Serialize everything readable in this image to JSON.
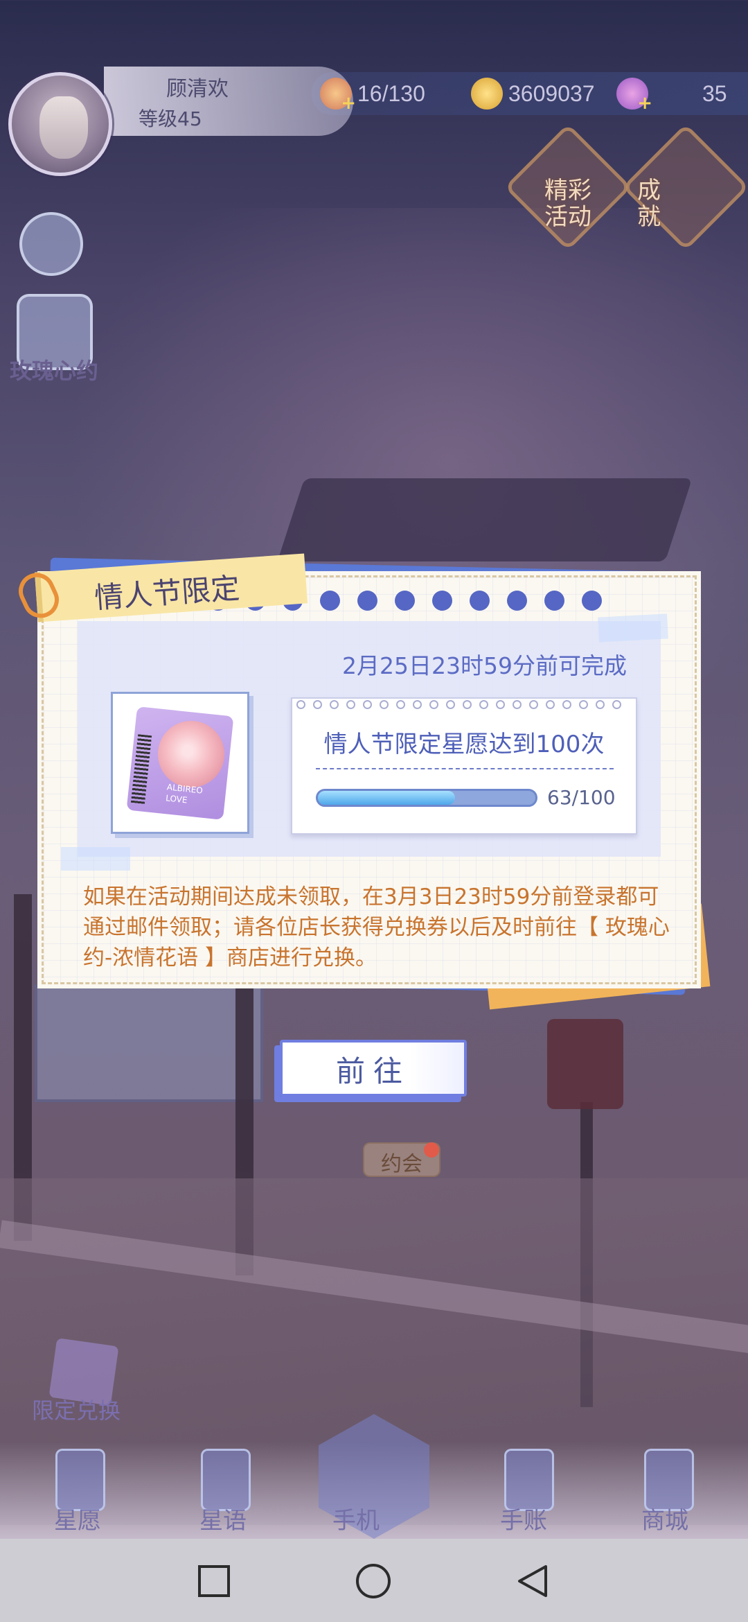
{
  "hud": {
    "player_name": "顾清欢",
    "player_level": "等级45",
    "stamina": "16/130",
    "gold": "3609037",
    "gems": "35",
    "plus_symbol": "+"
  },
  "top_icons": {
    "events_label": "精彩\n活动",
    "achievements_label": "成\n就"
  },
  "side": {
    "rose_promise_label": "玫瑰心约"
  },
  "modal": {
    "title": "情人节限定",
    "deadline": "2月25日23时59分前可完成",
    "task_text": "情人节限定星愿达到100次",
    "progress_text": "63/100",
    "progress_fraction": 0.63,
    "notice": "如果在活动期间达成未领取，在3月3日23时59分前登录都可通过邮件领取；请各位店长获得兑换券以后及时前往【 玫瑰心约-浓情花语 】商店进行兑换。",
    "ticket_text_1": "ALBIREO",
    "ticket_text_2": "LOVE"
  },
  "go_button": "前往",
  "scene": {
    "date_label": "约会",
    "limit_exchange": "限定兑换"
  },
  "nav": {
    "items": [
      {
        "label": "星愿",
        "icon": "question-card-icon"
      },
      {
        "label": "星语",
        "icon": "cards-icon"
      },
      {
        "label": "手机",
        "icon": "phone-icon"
      },
      {
        "label": "手账",
        "icon": "calendar-check-icon"
      },
      {
        "label": "商城",
        "icon": "shop-bag-icon"
      }
    ]
  },
  "colors": {
    "accent": "#5566c4",
    "notice": "#c8742e",
    "progress_fill": "#4ea7ea"
  }
}
